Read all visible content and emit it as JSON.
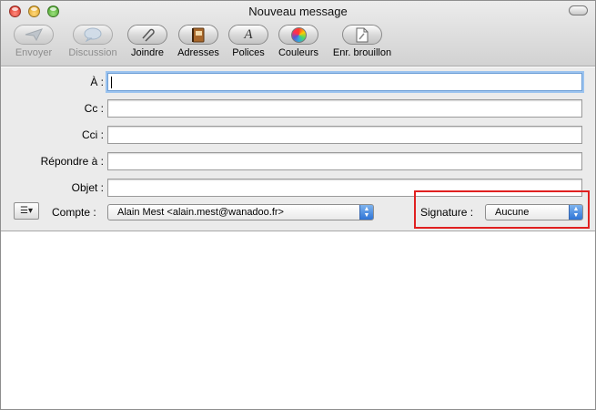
{
  "window": {
    "title": "Nouveau message"
  },
  "toolbar": {
    "send": "Envoyer",
    "discussion": "Discussion",
    "attach": "Joindre",
    "addresses": "Adresses",
    "fonts": "Polices",
    "colors": "Couleurs",
    "save_draft": "Enr. brouillon"
  },
  "fields": {
    "to_label": "À :",
    "cc_label": "Cc :",
    "bcc_label": "Cci :",
    "reply_to_label": "Répondre à :",
    "subject_label": "Objet :",
    "to_value": "",
    "cc_value": "",
    "bcc_value": "",
    "reply_to_value": "",
    "subject_value": ""
  },
  "account": {
    "label": "Compte :",
    "selected": "Alain Mest <alain.mest@wanadoo.fr>"
  },
  "signature": {
    "label": "Signature :",
    "selected": "Aucune"
  },
  "options_menu_glyph": "☰▾",
  "colors": {
    "highlight": "#e02020",
    "focus": "#9bc3ef",
    "popup_arrows": "#2f74d6"
  }
}
